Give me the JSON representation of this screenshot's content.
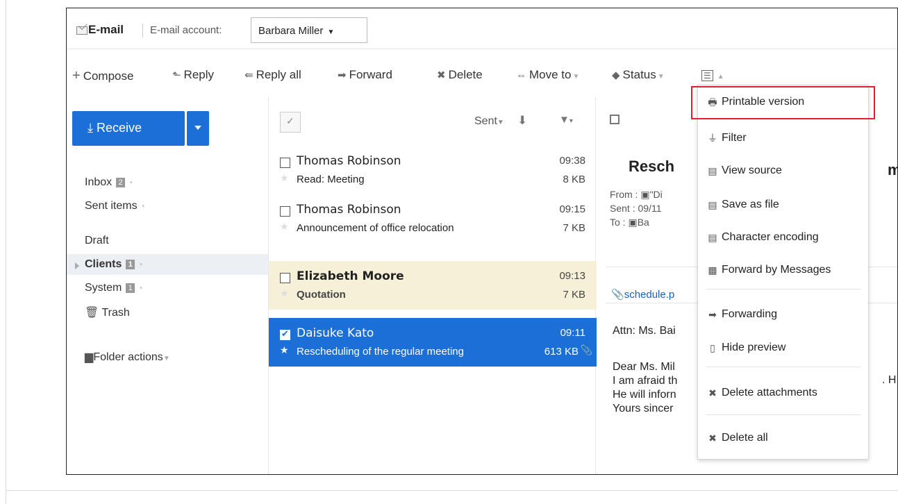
{
  "header": {
    "title": "E-mail",
    "account_label": "E-mail account:",
    "account_value": "Barbara Miller"
  },
  "toolbar": {
    "compose": "Compose",
    "reply": "Reply",
    "reply_all": "Reply all",
    "forward": "Forward",
    "delete": "Delete",
    "move_to": "Move to",
    "status": "Status"
  },
  "nav": {
    "receive": "Receive",
    "inbox": "Inbox",
    "inbox_count": "2",
    "sent": "Sent items",
    "draft": "Draft",
    "clients": "Clients",
    "clients_count": "1",
    "system": "System",
    "system_count": "1",
    "trash": "Trash",
    "folder_actions": "Folder actions"
  },
  "list": {
    "sort_label": "Sent",
    "rows": [
      {
        "from": "Thomas Robinson",
        "time": "09:38",
        "subject": "Read: Meeting",
        "size": "8 KB"
      },
      {
        "from": "Thomas Robinson",
        "time": "09:15",
        "subject": "Announcement of office relocation",
        "size": "7 KB"
      },
      {
        "from": "Elizabeth Moore",
        "time": "09:13",
        "subject": "Quotation",
        "size": "7 KB"
      },
      {
        "from": "Daisuke Kato",
        "time": "09:11",
        "subject": "Rescheduling of the regular meeting",
        "size": "613 KB"
      }
    ]
  },
  "preview": {
    "subject": "Resch",
    "subject_tail": "m",
    "from_label": "From",
    "from_value": "\"Di",
    "sent_label": "Sent",
    "sent_value": "09/11",
    "to_label": "To",
    "to_value": "Ba",
    "attachment": "schedule.p",
    "body_attn": "Attn: Ms. Bai",
    "body_dear": "Dear Ms. Mil",
    "body_afraid": "I am afraid th",
    "body_afraid_tail": ". H",
    "body_inform": "He will inforn",
    "body_yours": "Yours sincer"
  },
  "menu": {
    "items": [
      "Printable version",
      "Filter",
      "View source",
      "Save as file",
      "Character encoding",
      "Forward by Messages",
      "Forwarding",
      "Hide preview",
      "Delete attachments",
      "Delete all"
    ]
  },
  "colors": {
    "accent": "#1c6fd6",
    "highlight_row": "#f6f0d8",
    "menu_highlight_border": "#e02030"
  }
}
